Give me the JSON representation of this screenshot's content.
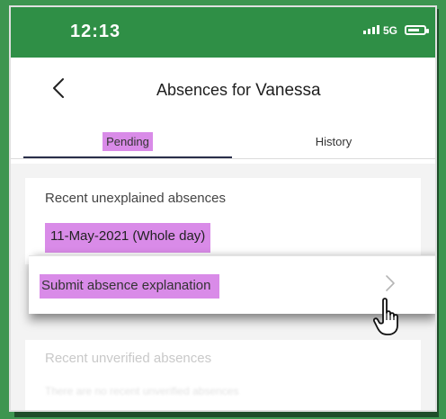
{
  "statusbar": {
    "time": "12:13",
    "network": "5G",
    "icons": [
      "signal-icon",
      "battery-icon"
    ]
  },
  "header": {
    "title": "Absences for",
    "name": "Vanessa",
    "back_icon": "chevron-left-icon"
  },
  "tabs": [
    {
      "label": "Pending",
      "selected": true
    },
    {
      "label": "History",
      "selected": false
    }
  ],
  "unexplained": {
    "label": "Recent unexplained absences",
    "items": [
      "11-May-2021 (Whole day)"
    ]
  },
  "submit": {
    "label": "Submit absence explanation",
    "icon": "chevron-right-icon"
  },
  "unverified": {
    "label": "Recent unverified absences",
    "text": "There are no recent unverified absences"
  },
  "colors": {
    "frame": "#3d9550",
    "statusbar": "#2f8f46",
    "highlight": "#d98be8",
    "tab_underline": "#2a2f4a"
  }
}
